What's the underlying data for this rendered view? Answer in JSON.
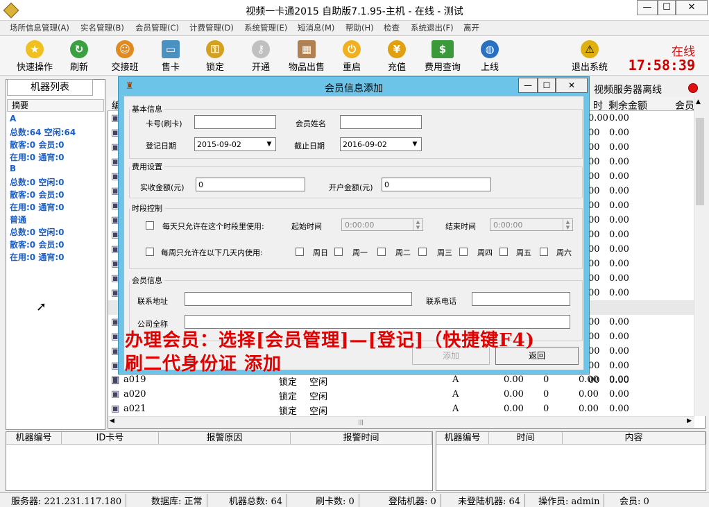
{
  "window": {
    "title": "视频一卡通2015 自助版7.1.95-主机 - 在线 - 测试",
    "btn_min": "—",
    "btn_max": "☐",
    "btn_close": "✕"
  },
  "menu": [
    "场所信息管理(A)",
    "实名管理(B)",
    "会员管理(C)",
    "计费管理(D)",
    "系统管理(E)",
    "短消息(M)",
    "帮助(H)",
    "检查",
    "系统退出(F)",
    "离开"
  ],
  "toolbar": [
    {
      "label": "快速操作",
      "icon": "star-icon"
    },
    {
      "label": "刷新",
      "icon": "refresh-icon"
    },
    {
      "label": "交接班",
      "icon": "users-icon"
    },
    {
      "label": "售卡",
      "icon": "card-icon"
    },
    {
      "label": "锁定",
      "icon": "lock-icon"
    },
    {
      "label": "开通",
      "icon": "key-icon"
    },
    {
      "label": "物品出售",
      "icon": "goods-icon"
    },
    {
      "label": "重启",
      "icon": "restart-icon"
    },
    {
      "label": "充值",
      "icon": "coins-icon"
    },
    {
      "label": "费用查询",
      "icon": "money-icon"
    },
    {
      "label": "上线",
      "icon": "globe-icon"
    }
  ],
  "exit_label": "退出系统",
  "status_online": "在线",
  "clock": "17:58:39",
  "left": {
    "tab": "机器列表",
    "header": "摘要",
    "groups": [
      {
        "name": "A",
        "lines": [
          "总数:64 空闲:64",
          "散客:0 会员:0",
          "在用:0 通宵:0"
        ]
      },
      {
        "name": "B",
        "lines": [
          "总数:0 空闲:0",
          "散客:0 会员:0",
          "在用:0 通宵:0"
        ]
      },
      {
        "name": "普通",
        "lines": [
          "总数:0 空闲:0",
          "散客:0 会员:0",
          "在用:0 通宵:0"
        ]
      }
    ]
  },
  "grid": {
    "headers": [
      "编",
      "时",
      "剩余金额",
      "会员"
    ],
    "rows": [
      {
        "id": "",
        "c1": "",
        "c2": "",
        "c3": "",
        "amt1": "0.00",
        "amt2": "0.00"
      },
      {
        "id": "",
        "c1": "",
        "c2": "",
        "c3": "",
        "amt1": "00",
        "amt2": "0.00"
      },
      {
        "id": "",
        "amt1": "00",
        "amt2": "0.00"
      },
      {
        "id": "",
        "amt1": "00",
        "amt2": "0.00"
      },
      {
        "id": "",
        "amt1": "00",
        "amt2": "0.00"
      },
      {
        "id": "",
        "amt1": "00",
        "amt2": "0.00"
      },
      {
        "id": "",
        "amt1": "00",
        "amt2": "0.00"
      },
      {
        "id": "",
        "amt1": "00",
        "amt2": "0.00"
      },
      {
        "id": "",
        "amt1": "00",
        "amt2": "0.00"
      },
      {
        "id": "",
        "amt1": "00",
        "amt2": "0.00"
      },
      {
        "id": "",
        "amt1": "00",
        "amt2": "0.00"
      },
      {
        "id": "",
        "amt1": "00",
        "amt2": "0.00"
      },
      {
        "id": "",
        "amt1": "00",
        "amt2": "0.00"
      },
      {
        "id": "",
        "amt1": "00",
        "amt2": "0.00"
      },
      {
        "id": "",
        "amt1": "00",
        "amt2": "0.00"
      },
      {
        "id": "",
        "amt1": "00",
        "amt2": "0.00"
      },
      {
        "id": "",
        "amt1": "00",
        "amt2": "0.00"
      },
      {
        "id": "",
        "amt1": "00",
        "amt2": "0.00"
      },
      {
        "id": "",
        "amt1": "00",
        "amt2": "0.00"
      }
    ],
    "bottom_rows": [
      {
        "id": "a019",
        "lock": "锁定",
        "state": "空闲",
        "grp": "A",
        "a": "0.00",
        "b": "0",
        "c": "0.00",
        "d": "0.00"
      },
      {
        "id": "a020",
        "lock": "锁定",
        "state": "空闲",
        "grp": "A",
        "a": "0.00",
        "b": "0",
        "c": "0.00",
        "d": "0.00"
      },
      {
        "id": "a021",
        "lock": "锁定",
        "state": "空闲",
        "grp": "A",
        "a": "0.00",
        "b": "0",
        "c": "0.00",
        "d": "0.00"
      }
    ]
  },
  "right_tab": "视频服务器离线",
  "bottom_left_headers": [
    "机器编号",
    "ID卡号",
    "报警原因",
    "报警时间"
  ],
  "bottom_right_headers": [
    "机器编号",
    "时间",
    "内容"
  ],
  "statusbar": [
    "服务器: 221.231.117.180",
    "数据库: 正常",
    "机器总数: 64",
    "刷卡数: 0",
    "登陆机器: 0",
    "未登陆机器: 64",
    "操作员: admin",
    "会员: 0"
  ],
  "dialog": {
    "title": "会员信息添加",
    "basic": {
      "legend": "基本信息",
      "card_label": "卡号(刷卡)",
      "card_value": "",
      "name_label": "会员姓名",
      "name_value": "",
      "reg_label": "登记日期",
      "reg_value": "2015-09-02",
      "exp_label": "截止日期",
      "exp_value": "2016-09-02"
    },
    "fee": {
      "legend": "费用设置",
      "paid_label": "实收金额(元)",
      "paid_value": "0",
      "open_label": "开户金额(元)",
      "open_value": "0"
    },
    "time": {
      "legend": "时段控制",
      "daily_label": "每天只允许在这个时段里使用:",
      "start_label": "起始时间",
      "start_value": "0:00:00",
      "end_label": "结束时间",
      "end_value": "0:00:00",
      "weekly_label": "每周只允许在以下几天内使用:",
      "days": [
        "周日",
        "周一",
        "周二",
        "周三",
        "周四",
        "周五",
        "周六"
      ]
    },
    "member": {
      "legend": "会员信息",
      "addr_label": "联系地址",
      "addr_value": "",
      "phone_label": "联系电话",
      "phone_value": "",
      "company_label": "公司全称"
    },
    "add_button": "添加",
    "back_button": "返回"
  },
  "overlay": {
    "line1": "办理会员：选择[会员管理]—[登记]（快捷键F4)",
    "line2": "刷二代身份证 添加"
  },
  "colors": {
    "accent": "#6cc4e8",
    "overlay": "#e00000",
    "clock": "#cc0000",
    "summary": "#1a5fc9"
  }
}
